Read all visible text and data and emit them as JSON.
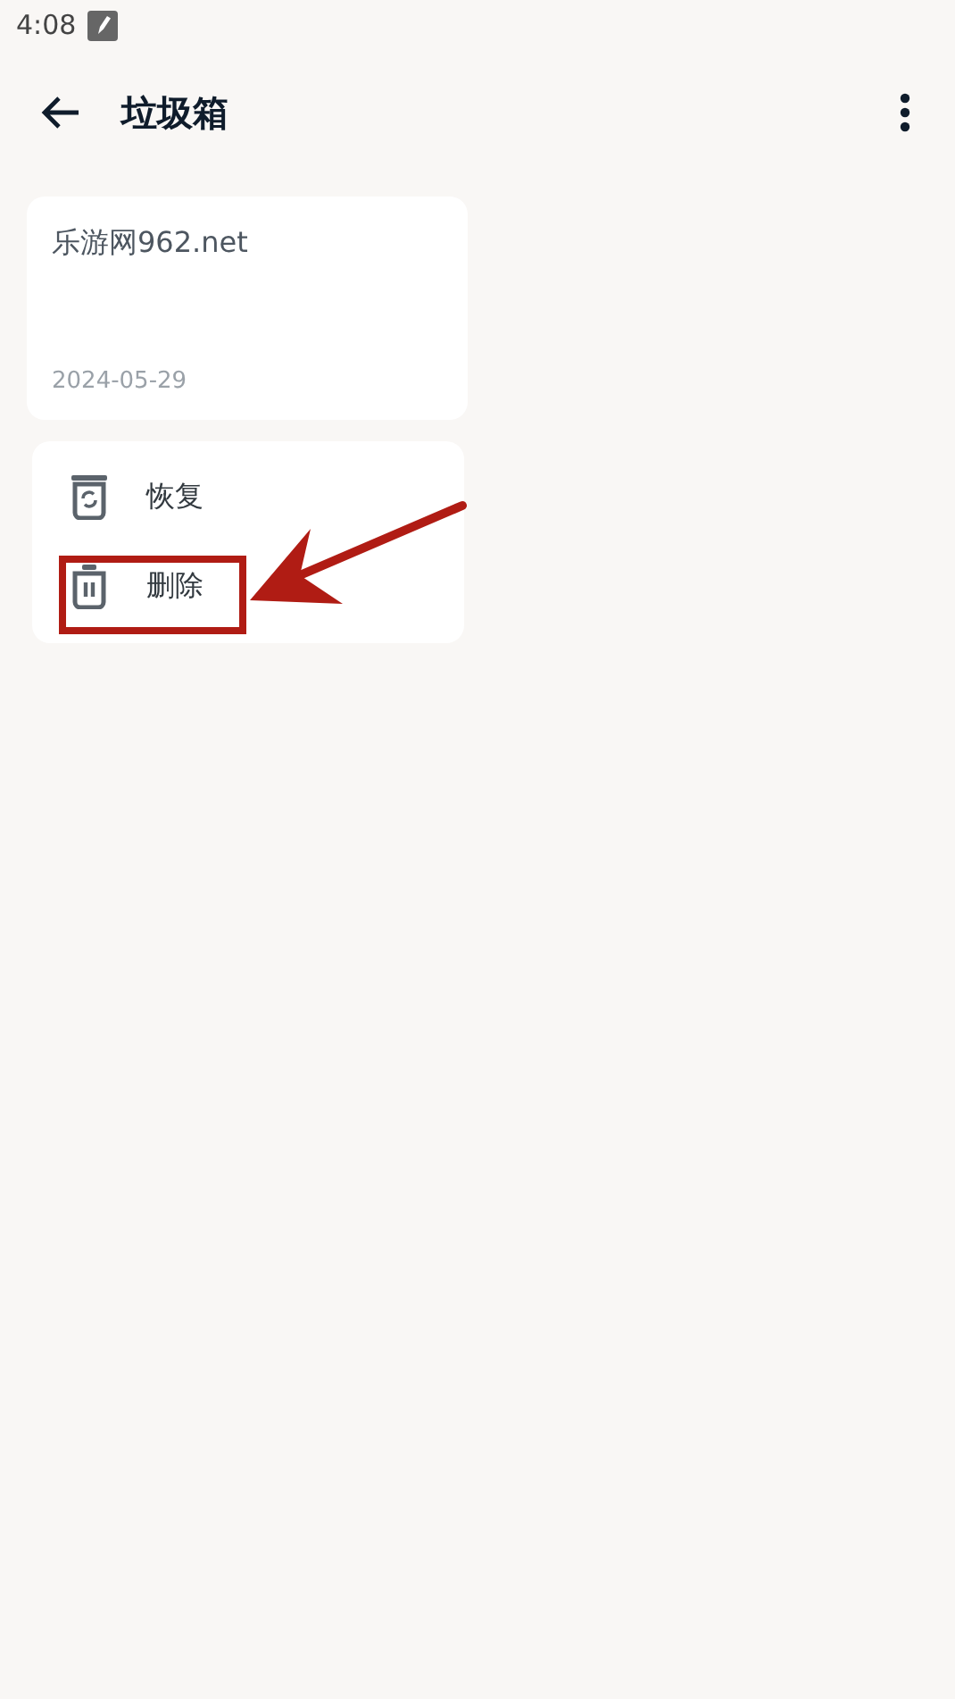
{
  "status_bar": {
    "time": "4:08"
  },
  "toolbar": {
    "title": "垃圾箱"
  },
  "notes": [
    {
      "text": "乐游网962.net",
      "date": "2024-05-29"
    }
  ],
  "menu": [
    {
      "kind": "restore",
      "label": "恢复",
      "highlighted": false
    },
    {
      "kind": "delete",
      "label": "删除",
      "highlighted": true
    }
  ]
}
